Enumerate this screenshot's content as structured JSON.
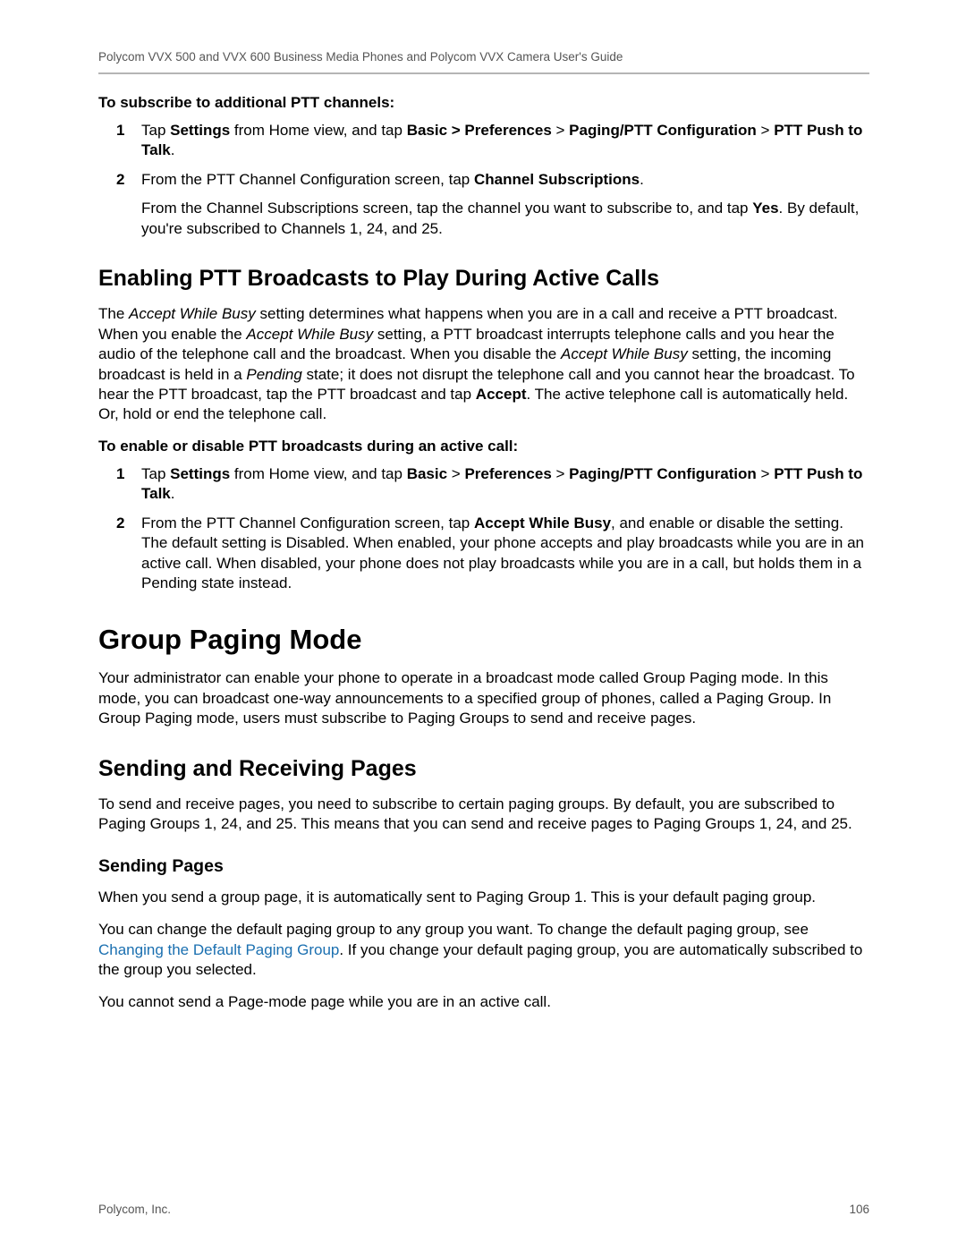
{
  "header": {
    "running": "Polycom VVX 500 and VVX 600 Business Media Phones and Polycom VVX Camera User's Guide"
  },
  "sect_subscribe": {
    "title": "To subscribe to additional PTT channels:",
    "step1_a": "Tap ",
    "step1_b": "Settings",
    "step1_c": " from Home view, and tap ",
    "step1_d": "Basic > Preferences",
    "step1_e": " > ",
    "step1_f": "Paging/PTT Configuration",
    "step1_g": " > ",
    "step1_h": "PTT Push to Talk",
    "step1_i": ".",
    "step2_a": "From the PTT Channel Configuration screen, tap ",
    "step2_b": "Channel Subscriptions",
    "step2_c": ".",
    "step2_sub_a": "From the Channel Subscriptions screen, tap the channel you want to subscribe to, and tap ",
    "step2_sub_b": "Yes",
    "step2_sub_c": ". By default, you're subscribed to Channels 1, 24, and 25."
  },
  "sect_enable": {
    "heading": "Enabling PTT Broadcasts to Play During Active Calls",
    "para_a": "The ",
    "para_b": "Accept While Busy",
    "para_c": " setting determines what happens when you are in a call and receive a PTT broadcast. When you enable the ",
    "para_d": "Accept While Busy",
    "para_e": " setting, a PTT broadcast interrupts telephone calls and you hear the audio of the telephone call and the broadcast. When you disable the ",
    "para_f": "Accept While Busy",
    "para_g": " setting, the incoming broadcast is held in a ",
    "para_h": "Pending",
    "para_i": " state; it does not disrupt the telephone call and you cannot hear the broadcast. To hear the PTT broadcast, tap the PTT broadcast and tap ",
    "para_j": "Accept",
    "para_k": ". The active telephone call is automatically held. Or, hold or end the telephone call.",
    "subtitle": "To enable or disable PTT broadcasts during an active call:",
    "step1_a": "Tap ",
    "step1_b": "Settings",
    "step1_c": " from Home view, and tap ",
    "step1_d": "Basic",
    "step1_e": " > ",
    "step1_f": "Preferences",
    "step1_g": " > ",
    "step1_h": "Paging/PTT Configuration",
    "step1_i": " > ",
    "step1_j": "PTT Push to Talk",
    "step1_k": ".",
    "step2_a": "From the PTT Channel Configuration screen, tap ",
    "step2_b": "Accept While Busy",
    "step2_c": ", and enable or disable the setting. The default setting is Disabled. When enabled, your phone accepts and play broadcasts while you are in an active call. When disabled, your phone does not play broadcasts while you are in a call, but holds them in a Pending state instead."
  },
  "sect_group": {
    "heading": "Group Paging Mode",
    "para": "Your administrator can enable your phone to operate in a broadcast mode called Group Paging mode. In this mode, you can broadcast one-way announcements to a specified group of phones, called a Paging Group. In Group Paging mode, users must subscribe to Paging Groups to send and receive pages."
  },
  "sect_sendrecv": {
    "heading": "Sending and Receiving Pages",
    "para": "To send and receive pages, you need to subscribe to certain paging groups. By default, you are subscribed to Paging Groups 1, 24, and 25. This means that you can send and receive pages to Paging Groups 1, 24, and 25."
  },
  "sect_sending": {
    "heading": "Sending Pages",
    "para1": "When you send a group page, it is automatically sent to Paging Group 1. This is your default paging group.",
    "para2_a": "You can change the default paging group to any group you want. To change the default paging group, see ",
    "para2_link": "Changing the Default Paging Group",
    "para2_b": ". If you change your default paging group, you are automatically subscribed to the group you selected.",
    "para3": "You cannot send a Page-mode page while you are in an active call."
  },
  "footer": {
    "left": "Polycom, Inc.",
    "right": "106"
  }
}
